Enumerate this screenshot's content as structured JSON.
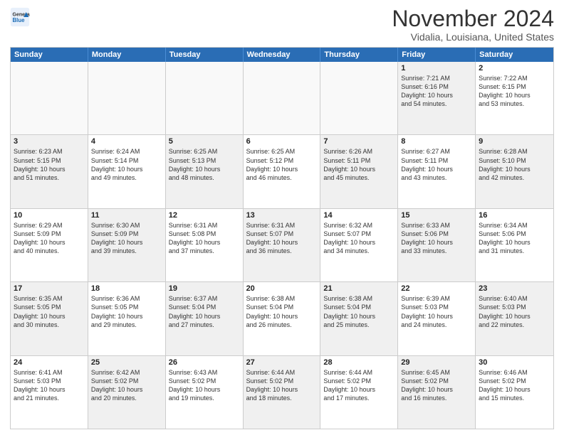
{
  "logo": {
    "line1": "General",
    "line2": "Blue"
  },
  "title": "November 2024",
  "subtitle": "Vidalia, Louisiana, United States",
  "header_days": [
    "Sunday",
    "Monday",
    "Tuesday",
    "Wednesday",
    "Thursday",
    "Friday",
    "Saturday"
  ],
  "weeks": [
    [
      {
        "day": "",
        "text": "",
        "empty": true
      },
      {
        "day": "",
        "text": "",
        "empty": true
      },
      {
        "day": "",
        "text": "",
        "empty": true
      },
      {
        "day": "",
        "text": "",
        "empty": true
      },
      {
        "day": "",
        "text": "",
        "empty": true
      },
      {
        "day": "1",
        "text": "Sunrise: 7:21 AM\nSunset: 6:16 PM\nDaylight: 10 hours\nand 54 minutes.",
        "empty": false,
        "shaded": true
      },
      {
        "day": "2",
        "text": "Sunrise: 7:22 AM\nSunset: 6:15 PM\nDaylight: 10 hours\nand 53 minutes.",
        "empty": false,
        "shaded": false
      }
    ],
    [
      {
        "day": "3",
        "text": "Sunrise: 6:23 AM\nSunset: 5:15 PM\nDaylight: 10 hours\nand 51 minutes.",
        "empty": false,
        "shaded": true
      },
      {
        "day": "4",
        "text": "Sunrise: 6:24 AM\nSunset: 5:14 PM\nDaylight: 10 hours\nand 49 minutes.",
        "empty": false,
        "shaded": false
      },
      {
        "day": "5",
        "text": "Sunrise: 6:25 AM\nSunset: 5:13 PM\nDaylight: 10 hours\nand 48 minutes.",
        "empty": false,
        "shaded": true
      },
      {
        "day": "6",
        "text": "Sunrise: 6:25 AM\nSunset: 5:12 PM\nDaylight: 10 hours\nand 46 minutes.",
        "empty": false,
        "shaded": false
      },
      {
        "day": "7",
        "text": "Sunrise: 6:26 AM\nSunset: 5:11 PM\nDaylight: 10 hours\nand 45 minutes.",
        "empty": false,
        "shaded": true
      },
      {
        "day": "8",
        "text": "Sunrise: 6:27 AM\nSunset: 5:11 PM\nDaylight: 10 hours\nand 43 minutes.",
        "empty": false,
        "shaded": false
      },
      {
        "day": "9",
        "text": "Sunrise: 6:28 AM\nSunset: 5:10 PM\nDaylight: 10 hours\nand 42 minutes.",
        "empty": false,
        "shaded": true
      }
    ],
    [
      {
        "day": "10",
        "text": "Sunrise: 6:29 AM\nSunset: 5:09 PM\nDaylight: 10 hours\nand 40 minutes.",
        "empty": false,
        "shaded": false
      },
      {
        "day": "11",
        "text": "Sunrise: 6:30 AM\nSunset: 5:09 PM\nDaylight: 10 hours\nand 39 minutes.",
        "empty": false,
        "shaded": true
      },
      {
        "day": "12",
        "text": "Sunrise: 6:31 AM\nSunset: 5:08 PM\nDaylight: 10 hours\nand 37 minutes.",
        "empty": false,
        "shaded": false
      },
      {
        "day": "13",
        "text": "Sunrise: 6:31 AM\nSunset: 5:07 PM\nDaylight: 10 hours\nand 36 minutes.",
        "empty": false,
        "shaded": true
      },
      {
        "day": "14",
        "text": "Sunrise: 6:32 AM\nSunset: 5:07 PM\nDaylight: 10 hours\nand 34 minutes.",
        "empty": false,
        "shaded": false
      },
      {
        "day": "15",
        "text": "Sunrise: 6:33 AM\nSunset: 5:06 PM\nDaylight: 10 hours\nand 33 minutes.",
        "empty": false,
        "shaded": true
      },
      {
        "day": "16",
        "text": "Sunrise: 6:34 AM\nSunset: 5:06 PM\nDaylight: 10 hours\nand 31 minutes.",
        "empty": false,
        "shaded": false
      }
    ],
    [
      {
        "day": "17",
        "text": "Sunrise: 6:35 AM\nSunset: 5:05 PM\nDaylight: 10 hours\nand 30 minutes.",
        "empty": false,
        "shaded": true
      },
      {
        "day": "18",
        "text": "Sunrise: 6:36 AM\nSunset: 5:05 PM\nDaylight: 10 hours\nand 29 minutes.",
        "empty": false,
        "shaded": false
      },
      {
        "day": "19",
        "text": "Sunrise: 6:37 AM\nSunset: 5:04 PM\nDaylight: 10 hours\nand 27 minutes.",
        "empty": false,
        "shaded": true
      },
      {
        "day": "20",
        "text": "Sunrise: 6:38 AM\nSunset: 5:04 PM\nDaylight: 10 hours\nand 26 minutes.",
        "empty": false,
        "shaded": false
      },
      {
        "day": "21",
        "text": "Sunrise: 6:38 AM\nSunset: 5:04 PM\nDaylight: 10 hours\nand 25 minutes.",
        "empty": false,
        "shaded": true
      },
      {
        "day": "22",
        "text": "Sunrise: 6:39 AM\nSunset: 5:03 PM\nDaylight: 10 hours\nand 24 minutes.",
        "empty": false,
        "shaded": false
      },
      {
        "day": "23",
        "text": "Sunrise: 6:40 AM\nSunset: 5:03 PM\nDaylight: 10 hours\nand 22 minutes.",
        "empty": false,
        "shaded": true
      }
    ],
    [
      {
        "day": "24",
        "text": "Sunrise: 6:41 AM\nSunset: 5:03 PM\nDaylight: 10 hours\nand 21 minutes.",
        "empty": false,
        "shaded": false
      },
      {
        "day": "25",
        "text": "Sunrise: 6:42 AM\nSunset: 5:02 PM\nDaylight: 10 hours\nand 20 minutes.",
        "empty": false,
        "shaded": true
      },
      {
        "day": "26",
        "text": "Sunrise: 6:43 AM\nSunset: 5:02 PM\nDaylight: 10 hours\nand 19 minutes.",
        "empty": false,
        "shaded": false
      },
      {
        "day": "27",
        "text": "Sunrise: 6:44 AM\nSunset: 5:02 PM\nDaylight: 10 hours\nand 18 minutes.",
        "empty": false,
        "shaded": true
      },
      {
        "day": "28",
        "text": "Sunrise: 6:44 AM\nSunset: 5:02 PM\nDaylight: 10 hours\nand 17 minutes.",
        "empty": false,
        "shaded": false
      },
      {
        "day": "29",
        "text": "Sunrise: 6:45 AM\nSunset: 5:02 PM\nDaylight: 10 hours\nand 16 minutes.",
        "empty": false,
        "shaded": true
      },
      {
        "day": "30",
        "text": "Sunrise: 6:46 AM\nSunset: 5:02 PM\nDaylight: 10 hours\nand 15 minutes.",
        "empty": false,
        "shaded": false
      }
    ]
  ]
}
